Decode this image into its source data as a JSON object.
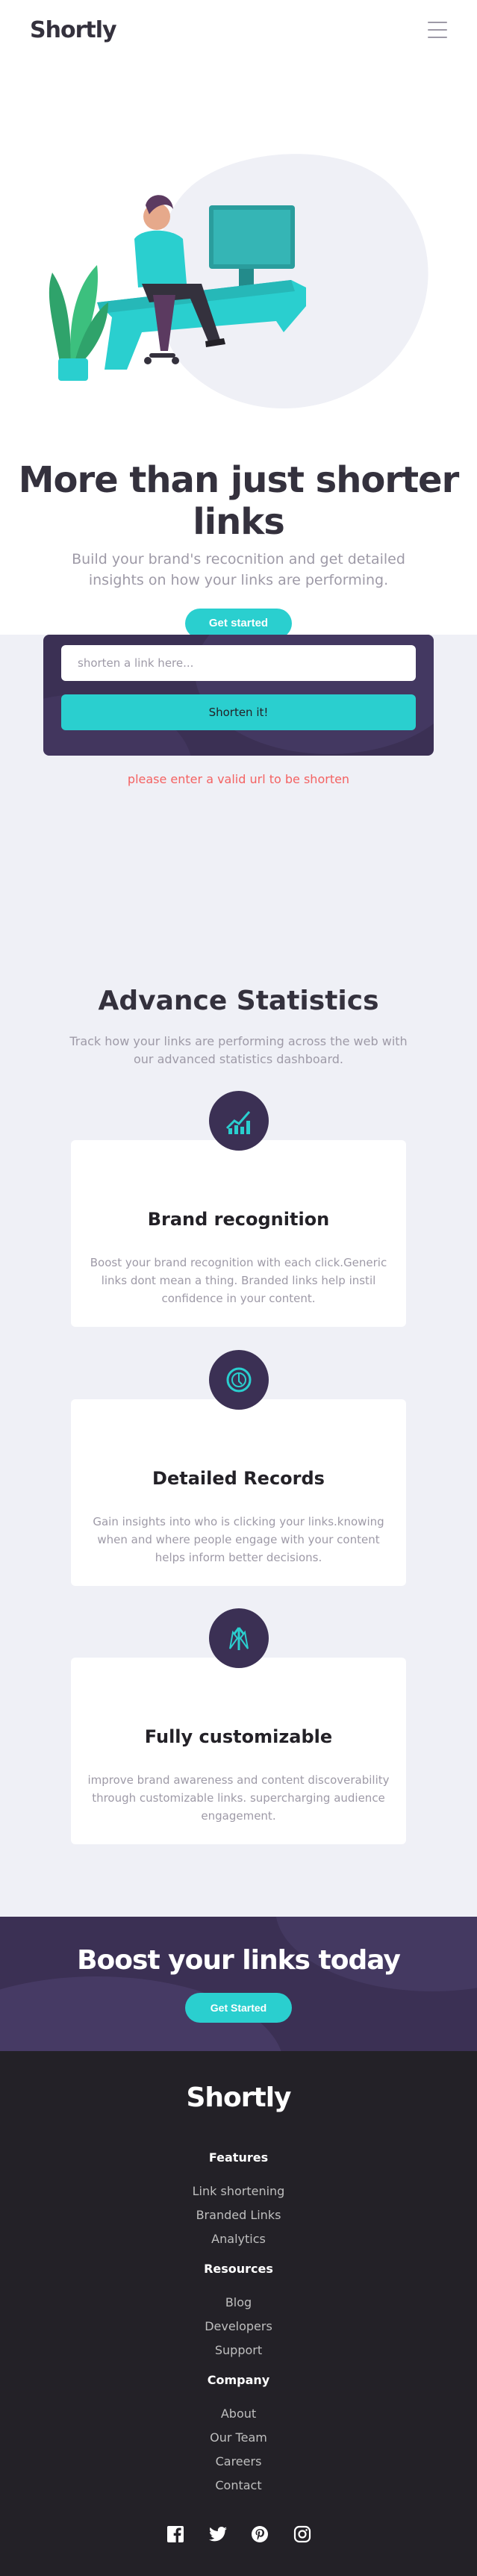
{
  "header": {
    "logo": "Shortly",
    "menu_icon": "hamburger-icon"
  },
  "hero": {
    "title": "More than just shorter links",
    "subtitle": "Build your brand's recocnition and get detailed insights on how your links are performing.",
    "cta": "Get started"
  },
  "shorten": {
    "placeholder": "shorten a link here...",
    "button": "Shorten it!",
    "error": "please enter a valid url to be shorten"
  },
  "statistics": {
    "title": "Advance Statistics",
    "subtitle": "Track how your links are performing across the web with our advanced statistics dashboard.",
    "cards": [
      {
        "icon": "brand-recognition-icon",
        "title": "Brand recognition",
        "text": "Boost your brand recognition with each click.Generic links dont mean a thing. Branded links help instil confidence in your content."
      },
      {
        "icon": "detailed-records-icon",
        "title": "Detailed Records",
        "text": "Gain insights into who is clicking your links.knowing when and where people engage with your content helps inform better decisions."
      },
      {
        "icon": "fully-customizable-icon",
        "title": "Fully customizable",
        "text": "improve brand awareness and content discoverability through customizable links. supercharging audience engagement."
      }
    ]
  },
  "boost": {
    "title": "Boost your links today",
    "cta": "Get Started"
  },
  "footer": {
    "logo": "Shortly",
    "sections": [
      {
        "title": "Features",
        "links": [
          "Link shortening",
          "Branded Links",
          "Analytics"
        ]
      },
      {
        "title": "Resources",
        "links": [
          "Blog",
          "Developers",
          "Support"
        ]
      },
      {
        "title": "Company",
        "links": [
          "About",
          "Our Team",
          "Careers",
          "Contact"
        ]
      }
    ],
    "social": [
      "facebook-icon",
      "twitter-icon",
      "pinterest-icon",
      "instagram-icon"
    ]
  },
  "colors": {
    "primary": "#2acfcf",
    "dark_violet": "#3b3054",
    "very_dark": "#232127",
    "gray": "#9e9aa7",
    "red": "#f46262",
    "light_bg": "#eff0f6"
  }
}
